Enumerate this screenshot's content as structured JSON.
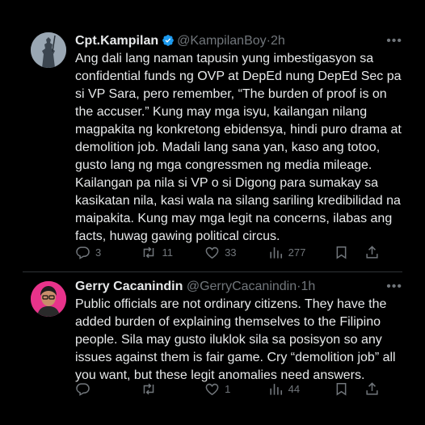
{
  "tweets": [
    {
      "author": {
        "display_name": "Cpt.Kampilan",
        "verified": true,
        "handle": "@KampilanBoy",
        "separator": "·",
        "time": "2h"
      },
      "more_icon": "ellipsis-icon",
      "text": "Ang dali lang naman tapusin yung imbestigasyon sa confidential funds ng OVP at DepEd nung DepEd Sec pa si VP Sara, pero remember, “The burden of proof is on the accuser.” Kung may mga isyu, kailangan nilang magpakita ng konkretong ebidensya, hindi puro drama at demolition job. Madali lang sana yan, kaso ang totoo, gusto lang ng mga congressmen ng media mileage. Kailangan pa nila si VP o si Digong para sumakay sa kasikatan nila, kasi wala na silang sariling kredibilidad na maipakita. Kung may mga legit na concerns, ilabas ang facts, huwag gawing political circus.",
      "stats": {
        "replies": "3",
        "reposts": "11",
        "likes": "33",
        "views": "277"
      }
    },
    {
      "author": {
        "display_name": "Gerry Cacanindin",
        "verified": false,
        "handle": "@GerryCacanindin",
        "separator": "·",
        "time": "1h"
      },
      "more_icon": "ellipsis-icon",
      "text": "Public officials are not ordinary citizens. They have the added burden of explaining themselves to the Filipino people. Sila may gusto iluklok sila sa posisyon so any issues against them is fair game. Cry “demolition job” all you want, but these legit anomalies need answers.",
      "stats": {
        "replies": "",
        "reposts": "",
        "likes": "1",
        "views": "44"
      }
    }
  ],
  "colors": {
    "background": "#000000",
    "text": "#e7e9ea",
    "muted": "#71767b",
    "verified": "#1d9bf0",
    "divider": "#2f3336",
    "avatar_gerry_bg": "#e8338b"
  }
}
